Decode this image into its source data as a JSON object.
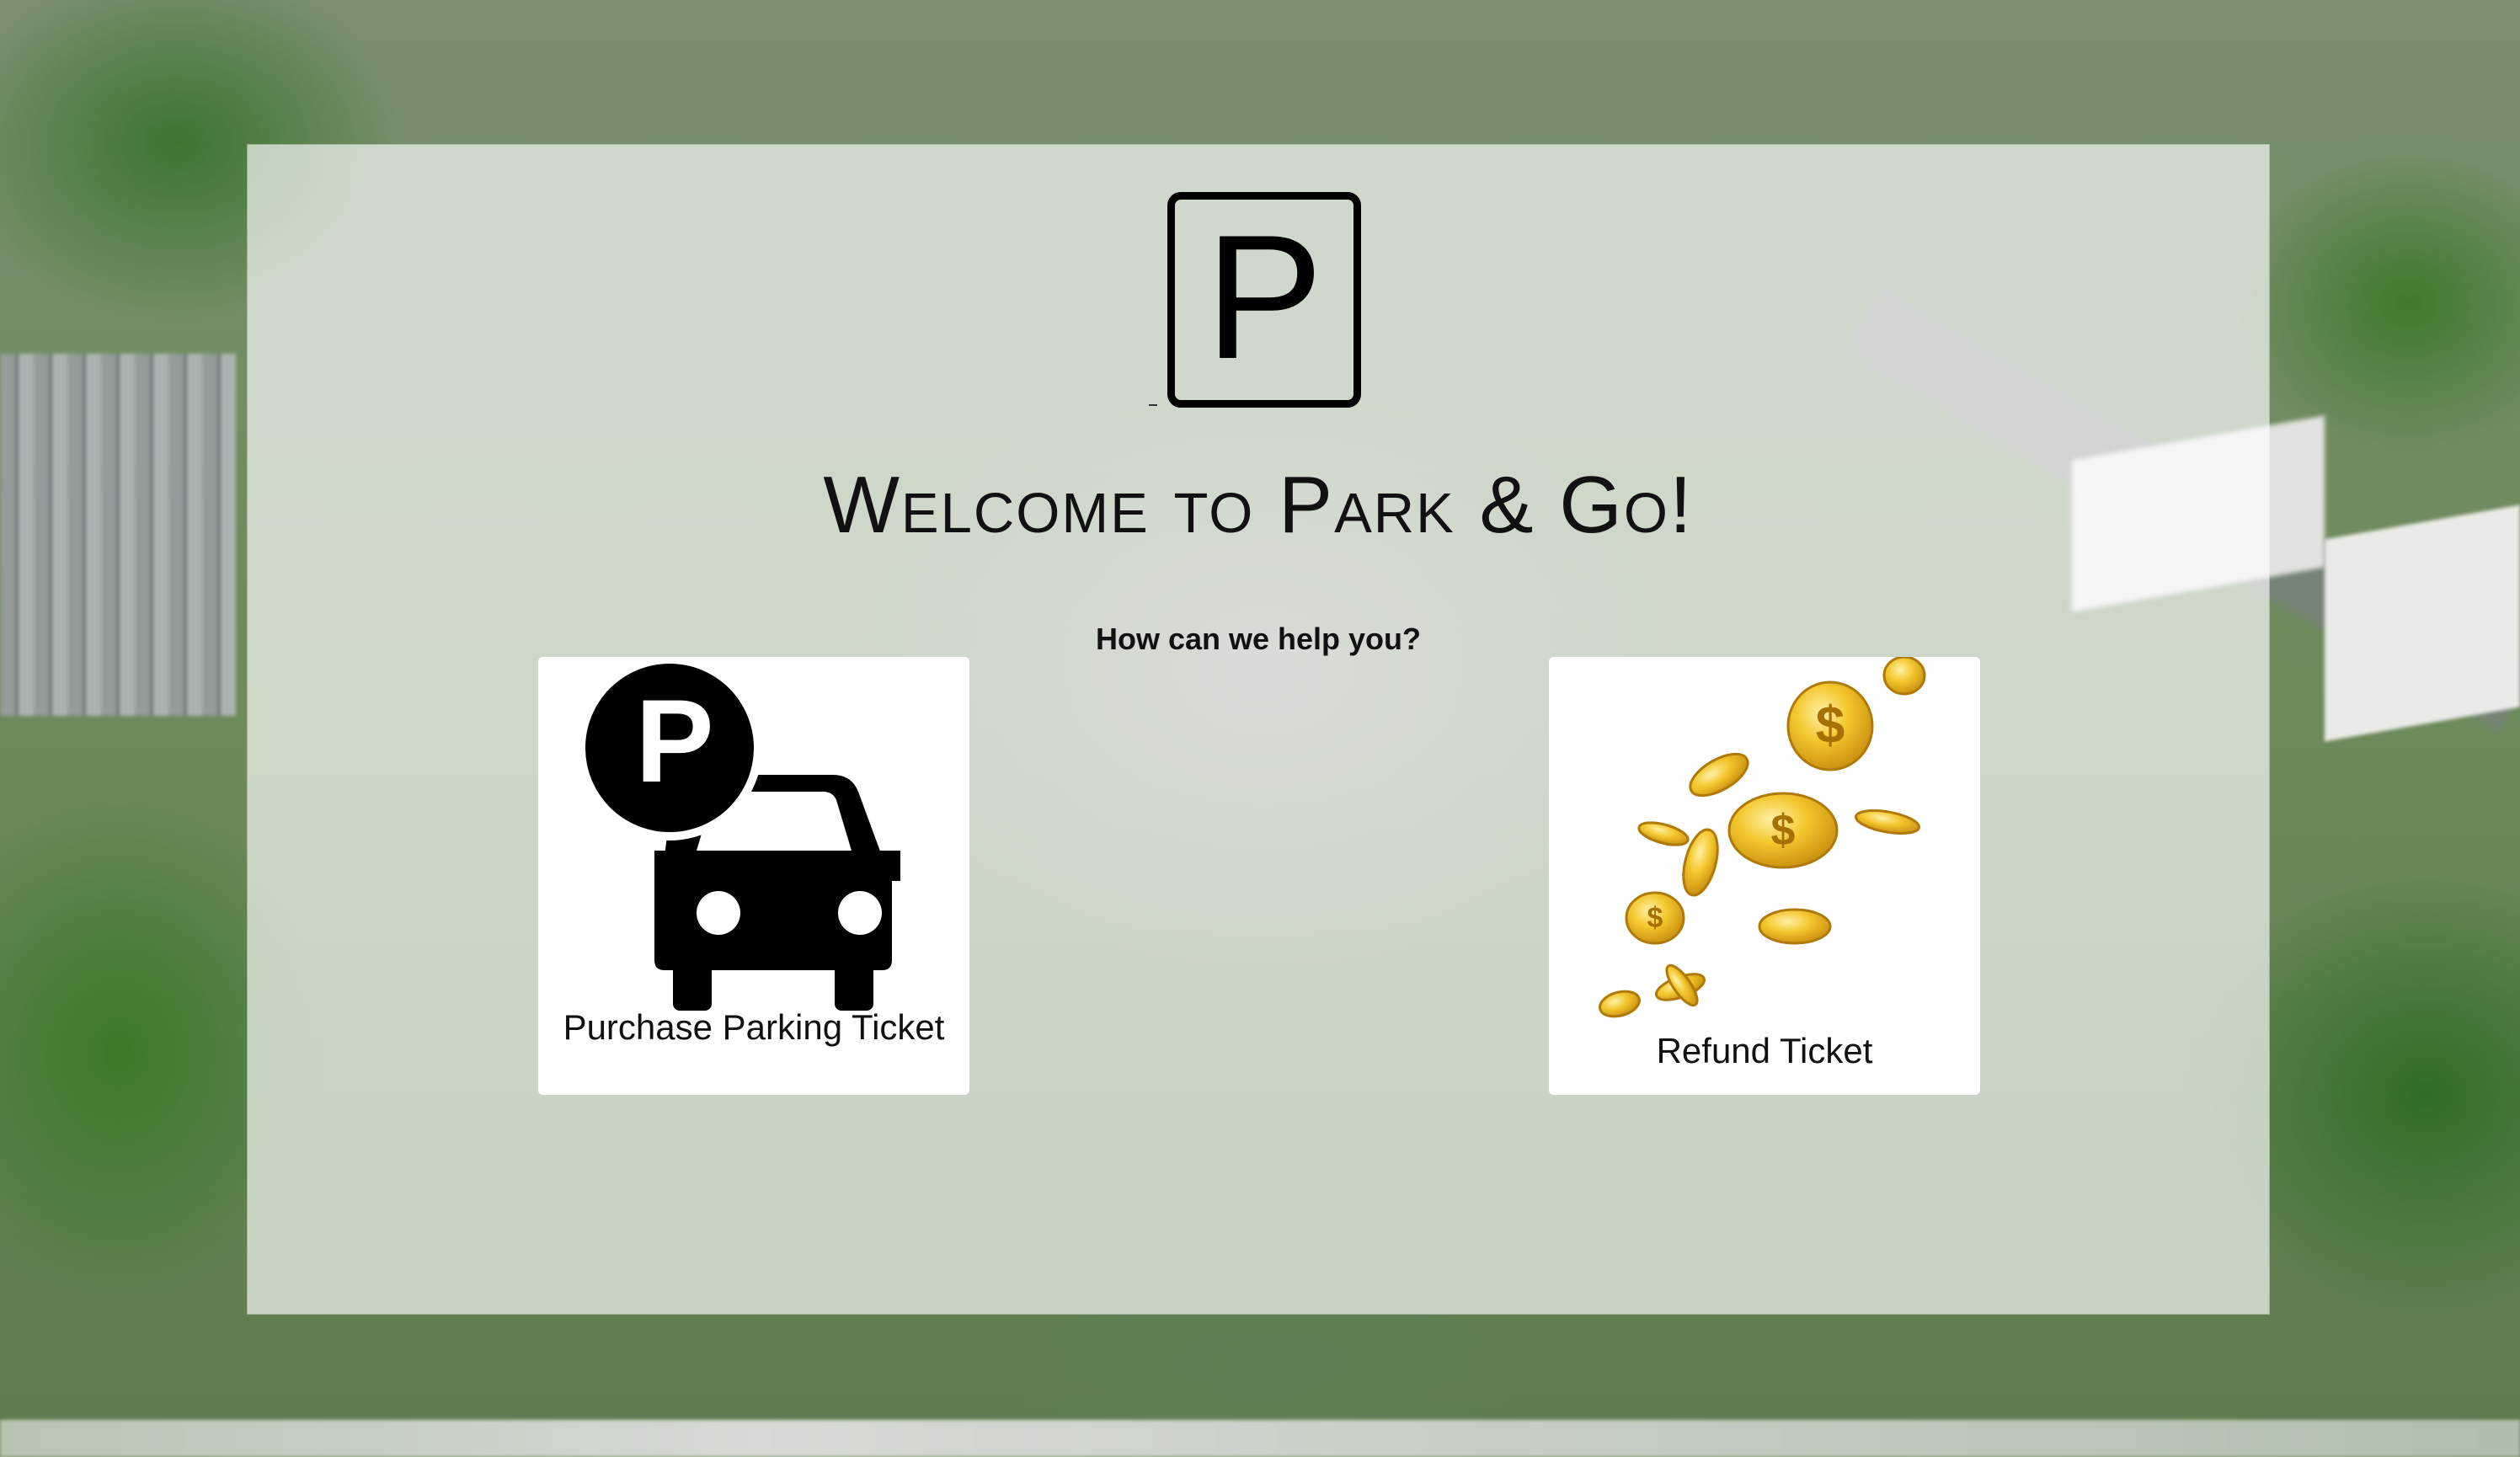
{
  "page": {
    "title": "Welcome to Park & Go!",
    "prompt": "How can we help you?"
  },
  "logo": {
    "letter": "P",
    "dash": "-",
    "icon": "parking-sign-icon"
  },
  "actions": [
    {
      "label": "Purchase Parking Ticket",
      "icon": "parking-car-icon",
      "badge_letter": "P"
    },
    {
      "label": "Refund Ticket",
      "icon": "gold-coins-icon",
      "coin_symbol": "$"
    }
  ],
  "colors": {
    "panel": "rgba(255,255,255,0.66)",
    "text": "#111111",
    "icon": "#000000",
    "coin": "#f2c230"
  }
}
